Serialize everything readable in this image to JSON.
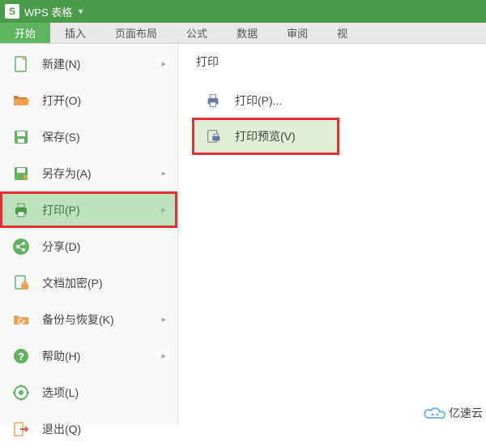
{
  "titlebar": {
    "app_name": "WPS 表格",
    "logo_letter": "S"
  },
  "tabs": [
    "开始",
    "插入",
    "页面布局",
    "公式",
    "数据",
    "审阅",
    "视"
  ],
  "sidebar": {
    "items": [
      {
        "label": "新建(N)",
        "has_sub": true
      },
      {
        "label": "打开(O)",
        "has_sub": false
      },
      {
        "label": "保存(S)",
        "has_sub": false
      },
      {
        "label": "另存为(A)",
        "has_sub": true
      },
      {
        "label": "打印(P)",
        "has_sub": true
      },
      {
        "label": "分享(D)",
        "has_sub": false
      },
      {
        "label": "文档加密(P)",
        "has_sub": false
      },
      {
        "label": "备份与恢复(K)",
        "has_sub": true
      },
      {
        "label": "帮助(H)",
        "has_sub": true
      },
      {
        "label": "选项(L)",
        "has_sub": false
      },
      {
        "label": "退出(Q)",
        "has_sub": false
      }
    ]
  },
  "panel": {
    "title": "打印",
    "items": [
      {
        "label": "打印(P)..."
      },
      {
        "label": "打印预览(V)"
      }
    ]
  },
  "watermark": {
    "text": "亿速云"
  }
}
